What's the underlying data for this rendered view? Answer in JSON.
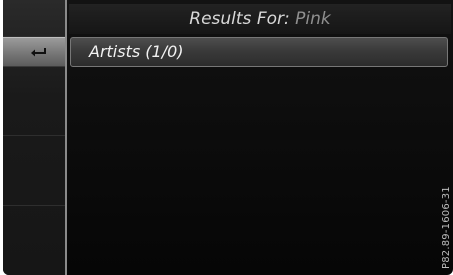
{
  "header": {
    "label": "Results For:",
    "term": "Pink"
  },
  "list": {
    "items": [
      {
        "label": "Artists (1/0)"
      }
    ]
  },
  "back_button": {
    "icon": "back-arrow-icon"
  },
  "reference_code": "P82.89-1606-31",
  "colors": {
    "background": "#0a0a0a",
    "selected_item": "#444444",
    "header_text": "#d8d8d8",
    "term_text": "#8f8f8f"
  }
}
